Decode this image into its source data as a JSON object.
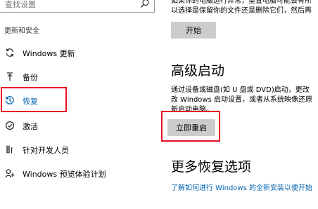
{
  "search": {
    "placeholder": "查找设置"
  },
  "sidebar": {
    "section_label": "更新和安全",
    "items": [
      {
        "label": "Windows 更新",
        "icon": "sync-icon"
      },
      {
        "label": "备份",
        "icon": "upload-icon"
      },
      {
        "label": "恢复",
        "icon": "history-icon",
        "selected": true
      },
      {
        "label": "激活",
        "icon": "check-circle-icon"
      },
      {
        "label": "针对开发人员",
        "icon": "developer-icon"
      },
      {
        "label": "Windows 预览体验计划",
        "icon": "insider-icon"
      }
    ]
  },
  "reset": {
    "line1": "如果你的电脑运行异常，重置电脑可能会有所",
    "line2": "以选择是保留你的文件还是删除它们，然后再",
    "button_label": "开始"
  },
  "advanced_startup": {
    "heading": "高级启动",
    "line1": "通过设备或磁盘(如 U 盘或 DVD)启动，更改",
    "line2": "改 Windows 启动设置，或者从系统映像还原",
    "line3": "新启动电脑。",
    "button_label": "立即重启"
  },
  "more_options": {
    "heading": "更多恢复选项",
    "link": "了解如何进行 Windows 的全新安装以便开始"
  },
  "colors": {
    "accent": "#0063b1",
    "highlight": "#e81123",
    "button_bg": "#cccccc"
  }
}
